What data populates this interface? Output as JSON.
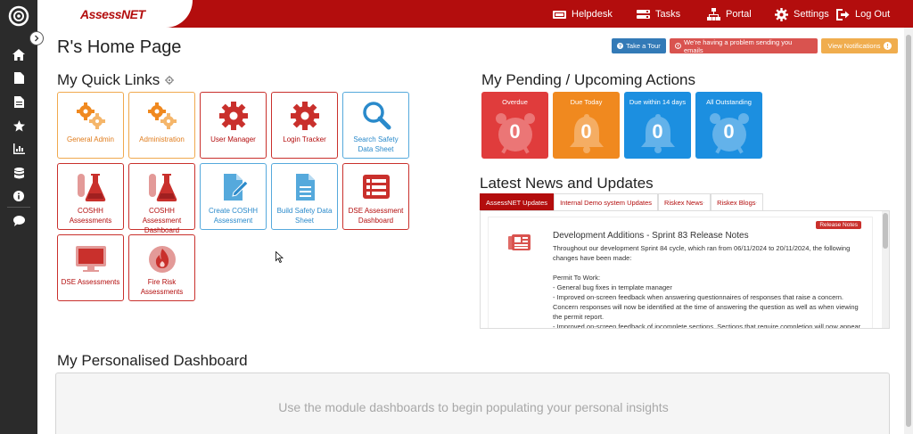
{
  "brand": {
    "main": "Assess",
    "suffix": "NET"
  },
  "top_nav": [
    {
      "label": "Helpdesk",
      "icon": "helpdesk-icon"
    },
    {
      "label": "Tasks",
      "icon": "tasks-icon"
    },
    {
      "label": "Portal",
      "icon": "portal-icon"
    },
    {
      "label": "Settings",
      "icon": "gear-icon"
    },
    {
      "label": "Log Out",
      "icon": "logout-icon"
    }
  ],
  "sidebar": {
    "icons": [
      "home-icon",
      "document-icon",
      "documents-icon",
      "star-icon",
      "reports-icon",
      "database-icon",
      "info-icon",
      "chat-icon"
    ]
  },
  "page": {
    "title": "R's Home Page",
    "buttons": {
      "tour": "Take a Tour",
      "email_problem": "We're having a problem sending you emails",
      "notifications": "View Notifications"
    }
  },
  "quick_links": {
    "heading": "My Quick Links",
    "tiles": [
      {
        "label": "General Admin",
        "icon": "gears-icon",
        "color": "orange"
      },
      {
        "label": "Administration",
        "icon": "gears-icon",
        "color": "orange"
      },
      {
        "label": "User Manager",
        "icon": "gear-icon",
        "color": "red"
      },
      {
        "label": "Login Tracker",
        "icon": "gear-icon",
        "color": "red"
      },
      {
        "label": "Search Safety Data Sheet",
        "icon": "search-icon",
        "color": "blue"
      },
      {
        "label": "COSHH Assessments",
        "icon": "flask-icon",
        "color": "red"
      },
      {
        "label": "COSHH Assessment Dashboard",
        "icon": "flask-icon",
        "color": "red"
      },
      {
        "label": "Create COSHH Assessment",
        "icon": "edit-document-icon",
        "color": "blue"
      },
      {
        "label": "Build Safety Data Sheet",
        "icon": "document-icon",
        "color": "blue"
      },
      {
        "label": "DSE Assessment Dashboard",
        "icon": "list-icon",
        "color": "red"
      },
      {
        "label": "DSE Assessments",
        "icon": "monitor-icon",
        "color": "red"
      },
      {
        "label": "Fire Risk Assessments",
        "icon": "fire-icon",
        "color": "red"
      }
    ]
  },
  "pending": {
    "heading": "My Pending / Upcoming Actions",
    "items": [
      {
        "label": "Overdue",
        "count": "0",
        "color": "#e03c3c"
      },
      {
        "label": "Due Today",
        "count": "0",
        "color": "#f0891f"
      },
      {
        "label": "Due within 14 days",
        "count": "0",
        "color": "#1c8fe0"
      },
      {
        "label": "All Outstanding",
        "count": "0",
        "color": "#1c8fe0"
      }
    ]
  },
  "news": {
    "heading": "Latest News and Updates",
    "tabs": [
      "AssessNET Updates",
      "Internal Demo system Updates",
      "Riskex News",
      "Riskex Blogs"
    ],
    "badge": "Release Notes",
    "title": "Development Additions - Sprint 83 Release Notes",
    "body": [
      "Throughout our development Sprint 84 cycle, which ran from 06/11/2024 to 20/11/2024, the following changes have been made:",
      "",
      "Permit To Work:",
      "- General bug fixes in template manager",
      "- Improved on-screen feedback when answering questionnaires of responses that raise a concern. Concern responses will now be identified at the time of answering the question as well as when viewing the permit report.",
      "- Improved on-screen feedback of incomplete sections. Sections that require completion will now appear"
    ]
  },
  "dashboard": {
    "heading": "My Personalised Dashboard",
    "message": "Use the module dashboards to begin populating your personal insights"
  },
  "colors": {
    "brand_red": "#b30d0d",
    "tour_blue": "#337ab7",
    "email_red": "#d9534f",
    "notify_orange": "#f0ad4e"
  }
}
